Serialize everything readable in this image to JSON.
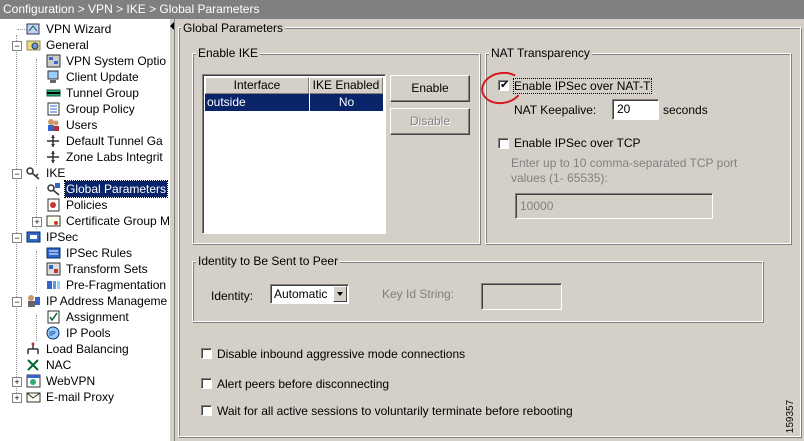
{
  "breadcrumb": "Configuration > VPN > IKE > Global Parameters",
  "tree": [
    {
      "label": "VPN Wizard",
      "icon": "wizard-icon"
    },
    {
      "label": "General",
      "icon": "folder-gear-icon"
    },
    {
      "label": "VPN System Optio",
      "icon": "system-options-icon"
    },
    {
      "label": "Client Update",
      "icon": "client-update-icon"
    },
    {
      "label": "Tunnel Group",
      "icon": "tunnel-group-icon"
    },
    {
      "label": "Group Policy",
      "icon": "group-policy-icon"
    },
    {
      "label": "Users",
      "icon": "users-icon"
    },
    {
      "label": "Default Tunnel Ga",
      "icon": "tunnel-gateway-icon"
    },
    {
      "label": "Zone Labs Integrit",
      "icon": "zone-labs-icon"
    },
    {
      "label": "IKE",
      "icon": "key-icon"
    },
    {
      "label": "Global Parameters",
      "icon": "global-params-icon"
    },
    {
      "label": "Policies",
      "icon": "policies-icon"
    },
    {
      "label": "Certificate Group M",
      "icon": "certificate-icon"
    },
    {
      "label": "IPSec",
      "icon": "ipsec-icon"
    },
    {
      "label": "IPSec Rules",
      "icon": "ipsec-rules-icon"
    },
    {
      "label": "Transform Sets",
      "icon": "transform-sets-icon"
    },
    {
      "label": "Pre-Fragmentation",
      "icon": "pre-fragmentation-icon"
    },
    {
      "label": "IP Address Manageme",
      "icon": "ip-address-icon"
    },
    {
      "label": "Assignment",
      "icon": "assignment-icon"
    },
    {
      "label": "IP Pools",
      "icon": "ip-pools-icon"
    },
    {
      "label": "Load Balancing",
      "icon": "load-balancing-icon"
    },
    {
      "label": "NAC",
      "icon": "nac-icon"
    },
    {
      "label": "WebVPN",
      "icon": "webvpn-icon"
    },
    {
      "label": "E-mail Proxy",
      "icon": "email-proxy-icon"
    }
  ],
  "main": {
    "title": "Global Parameters",
    "enable_ike": {
      "legend": "Enable IKE",
      "columns": [
        "Interface",
        "IKE Enabled"
      ],
      "rows": [
        {
          "interface": "outside",
          "enabled": "No"
        }
      ],
      "enable_label": "Enable",
      "disable_label": "Disable"
    },
    "nat": {
      "legend": "NAT Transparency",
      "ipsec_nat_t": "Enable IPSec over NAT-T",
      "keepalive_label": "NAT Keepalive:",
      "keepalive_value": "20",
      "seconds": "seconds",
      "ipsec_tcp": "Enable IPSec over TCP",
      "tcp_hint_1": "Enter up to 10 comma-separated TCP port",
      "tcp_hint_2": "values  (1- 65535):",
      "tcp_ports": "10000"
    },
    "identity": {
      "legend": "Identity to Be Sent to Peer",
      "identity_label": "Identity:",
      "identity_value": "Automatic",
      "keyid_label": "Key Id String:",
      "keyid_value": ""
    },
    "options": [
      "Disable inbound aggressive mode connections",
      "Alert peers before disconnecting",
      "Wait for all active sessions to voluntarily terminate before rebooting"
    ]
  },
  "figure_id": "159357",
  "colors": {
    "selection": "#0a246a",
    "panel": "#d4d0c8",
    "annotation": "#d51a1a",
    "breadcrumb_bg": "#808080"
  }
}
